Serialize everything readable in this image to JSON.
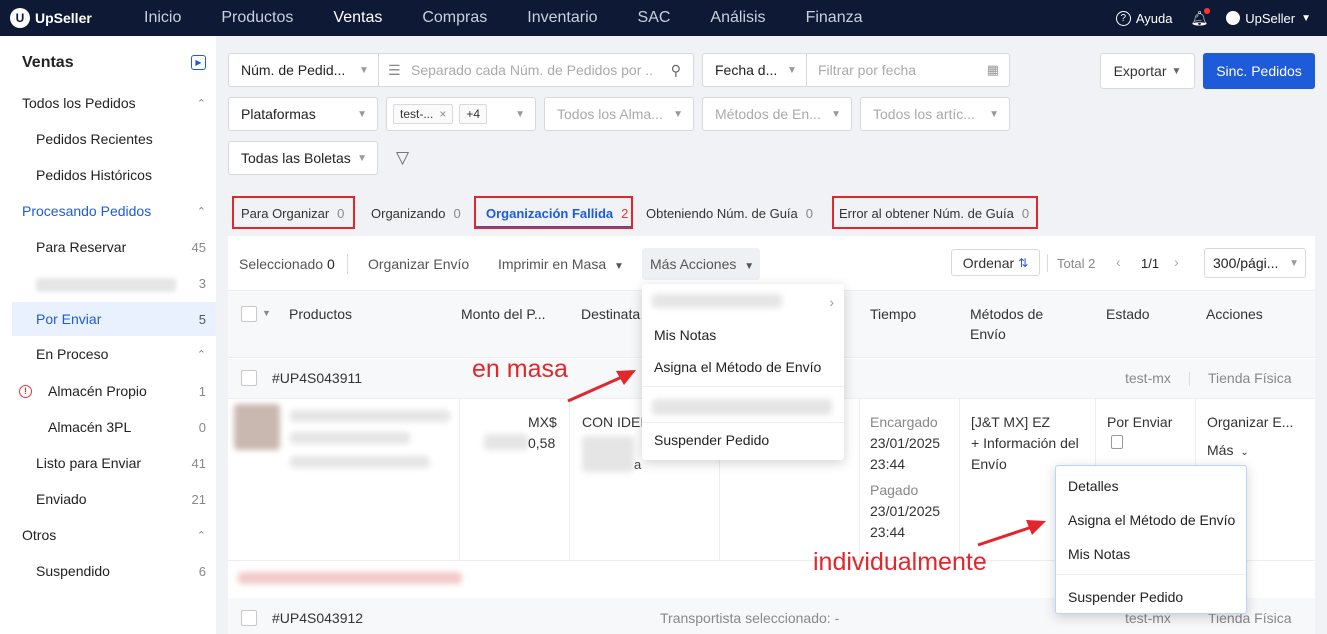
{
  "brand": {
    "name": "UpSeller"
  },
  "nav": {
    "items": [
      "Inicio",
      "Productos",
      "Ventas",
      "Compras",
      "Inventario",
      "SAC",
      "Análisis",
      "Finanza"
    ],
    "help": "Ayuda",
    "user": "UpSeller"
  },
  "sidebar": {
    "title": "Ventas",
    "items": [
      {
        "label": "Todos los Pedidos",
        "count": ""
      },
      {
        "label": "Pedidos Recientes",
        "count": ""
      },
      {
        "label": "Pedidos Históricos",
        "count": ""
      },
      {
        "label": "Procesando Pedidos",
        "count": ""
      },
      {
        "label": "Para Reservar",
        "count": "45"
      },
      {
        "label": "",
        "count": "3"
      },
      {
        "label": "Por Enviar",
        "count": "5"
      },
      {
        "label": "En Proceso",
        "count": ""
      },
      {
        "label": "Almacén Propio",
        "count": "1"
      },
      {
        "label": "Almacén 3PL",
        "count": "0"
      },
      {
        "label": "Listo para Enviar",
        "count": "41"
      },
      {
        "label": "Enviado",
        "count": "21"
      },
      {
        "label": "Otros",
        "count": ""
      },
      {
        "label": "Suspendido",
        "count": "6"
      }
    ]
  },
  "filters": {
    "order_num": "Núm. de Pedid...",
    "search_placeholder": "Separado cada Núm. de Pedidos por ...",
    "date_type": "Fecha d...",
    "date_placeholder": "Filtrar por fecha",
    "platforms": "Plataformas",
    "store_tag": "test-...",
    "store_more": "+4",
    "warehouses": "Todos los Alma...",
    "shipping_methods": "Métodos de En...",
    "articles": "Todos los artíc...",
    "tickets": "Todas las Boletas"
  },
  "buttons": {
    "export": "Exportar",
    "sync": "Sinc. Pedidos"
  },
  "tabs": [
    {
      "label": "Para Organizar",
      "count": "0"
    },
    {
      "label": "Organizando",
      "count": "0"
    },
    {
      "label": "Organización Fallida",
      "count": "2"
    },
    {
      "label": "Obteniendo Núm. de Guía",
      "count": "0"
    },
    {
      "label": "Error al obtener Núm. de Guía",
      "count": "0"
    }
  ],
  "toolbar": {
    "selected_label": "Seleccionado",
    "selected_count": "0",
    "arrange": "Organizar Envío",
    "bulk_print": "Imprimir en Masa",
    "more_actions": "Más Acciones",
    "sort": "Ordenar",
    "total": "Total 2",
    "page": "1/1",
    "per_page": "300/pági..."
  },
  "columns": {
    "products": "Productos",
    "amount": "Monto del P...",
    "recipient": "Destinata",
    "time": "Tiempo",
    "shipping": "Métodos de",
    "shipping2": "Envío",
    "status": "Estado",
    "actions": "Acciones"
  },
  "orders": [
    {
      "id": "#UP4S043911",
      "store": "test-mx",
      "channel": "Tienda Física",
      "currency": "MX$",
      "amount": "0,58",
      "recipient": "CON IDEI",
      "recipient_suffix": "a",
      "time_ordered_label": "Encargado",
      "time_ordered_date": "23/01/2025",
      "time_ordered_hour": "23:44",
      "time_paid_label": "Pagado",
      "time_paid_date": "23/01/2025",
      "time_paid_hour": "23:44",
      "shipping_method": "[J&T MX] EZ",
      "shipping_more": "+ Información del",
      "shipping_more2": "Envío",
      "status": "Por Enviar",
      "action_primary": "Organizar E...",
      "action_more": "Más"
    },
    {
      "id": "#UP4S043912",
      "carrier": "Transportista seleccionado: -",
      "store": "test-mx",
      "channel": "Tienda Física"
    }
  ],
  "bulk_menu": {
    "items": [
      "Mis Notas",
      "Asigna el Método de Envío",
      "Suspender Pedido"
    ]
  },
  "row_menu": {
    "items": [
      "Detalles",
      "Asigna el Método de Envío",
      "Mis Notas",
      "Suspender Pedido"
    ]
  },
  "annotations": {
    "bulk": "en masa",
    "individual": "individualmente"
  },
  "colors": {
    "nav_bg": "#0e1a35",
    "primary": "#1e5bd8",
    "highlight": "#e3262b"
  }
}
